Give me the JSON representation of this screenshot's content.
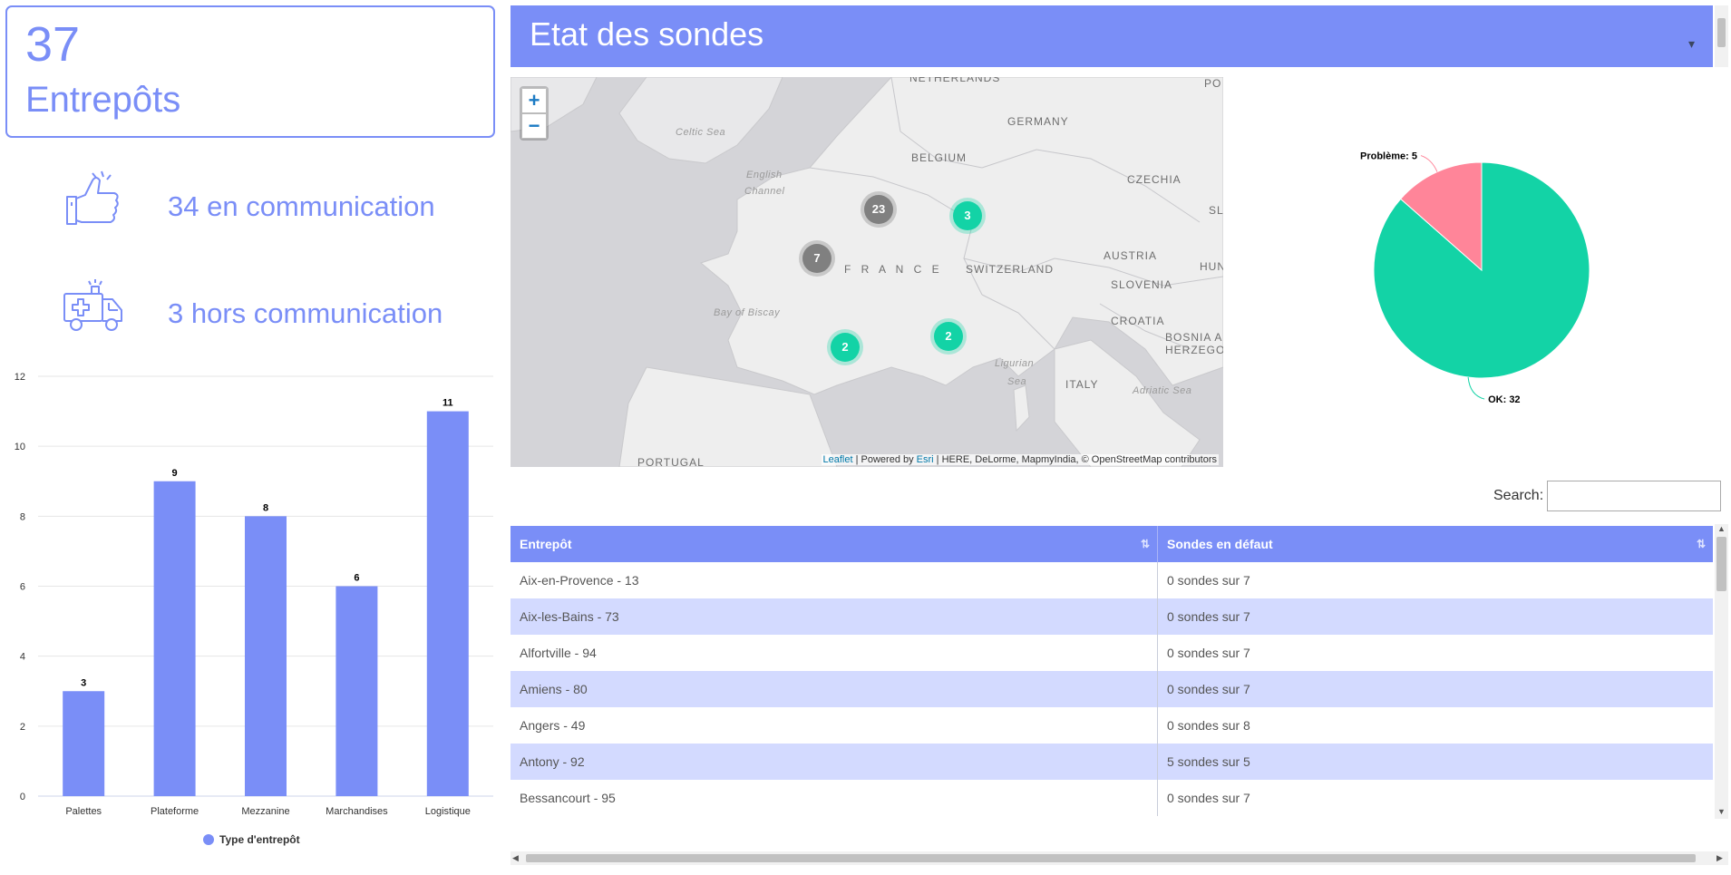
{
  "kpi": {
    "count": "37",
    "label": "Entrepôts"
  },
  "status": {
    "online": "34 en communication",
    "offline": "3 hors communication",
    "online_icon": "thumbs-up-icon",
    "offline_icon": "ambulance-icon"
  },
  "header": {
    "title": "Etat des sondes"
  },
  "map": {
    "zoom_in": "+",
    "zoom_out": "−",
    "labels": {
      "netherlands": "NETHERLANDS",
      "germany": "GERMANY",
      "belgium": "BELGIUM",
      "czechia": "CZECHIA",
      "france": "F R A N C E",
      "switzerland": "SWITZERLAND",
      "austria": "AUSTRIA",
      "slovenia": "SLOVENIA",
      "croatia": "CROATIA",
      "bosnia1": "BOSNIA AN",
      "bosnia2": "HERZEGOVI",
      "italy": "ITALY",
      "portugal": "PORTUGAL",
      "po": "PO",
      "sl": "SL",
      "hu": "HUN",
      "celtic": "Celtic Sea",
      "english1": "English",
      "english2": "Channel",
      "biscay": "Bay of Biscay",
      "ligurian1": "Ligurian",
      "ligurian2": "Sea",
      "adriatic": "Adriatic Sea"
    },
    "clusters": {
      "paris": "23",
      "west": "7",
      "east": "3",
      "southwest": "2",
      "southeast": "2"
    },
    "attribution": {
      "leaflet": "Leaflet",
      "sep1": " | Powered by ",
      "esri": "Esri",
      "rest": " | HERE, DeLorme, MapmyIndia, © OpenStreetMap contributors"
    },
    "colors": {
      "cluster_ok": "#13d3a6",
      "cluster_mixed": "#808080"
    }
  },
  "search": {
    "label": "Search:",
    "value": ""
  },
  "table": {
    "headers": [
      "Entrepôt",
      "Sondes en défaut"
    ],
    "sort_icon": "⇅",
    "rows": [
      [
        "Aix-en-Provence - 13",
        "0 sondes sur 7"
      ],
      [
        "Aix-les-Bains - 73",
        "0 sondes sur 7"
      ],
      [
        "Alfortville - 94",
        "0 sondes sur 7"
      ],
      [
        "Amiens - 80",
        "0 sondes sur 7"
      ],
      [
        "Angers - 49",
        "0 sondes sur 8"
      ],
      [
        "Antony - 92",
        "5 sondes sur 5"
      ],
      [
        "Bessancourt - 95",
        "0 sondes sur 7"
      ]
    ]
  },
  "chart_data": [
    {
      "type": "bar",
      "categories": [
        "Palettes",
        "Plateforme",
        "Mezzanine",
        "Marchandises",
        "Logistique"
      ],
      "values": [
        3,
        9,
        8,
        6,
        11
      ],
      "series": [
        {
          "name": "Type d'entrepôt",
          "values": [
            3,
            9,
            8,
            6,
            11
          ]
        }
      ],
      "yticks": [
        "0",
        "2",
        "4",
        "6",
        "8",
        "10",
        "12"
      ],
      "ylim": [
        0,
        12
      ],
      "grid": true,
      "legend": "bottom",
      "color": "#7a8ef7"
    },
    {
      "type": "pie",
      "slices": [
        {
          "label": "OK: 32",
          "value": 32,
          "color": "#13d3a6"
        },
        {
          "label": "Problème: 5",
          "value": 5,
          "color": "#ff8599"
        }
      ]
    }
  ]
}
